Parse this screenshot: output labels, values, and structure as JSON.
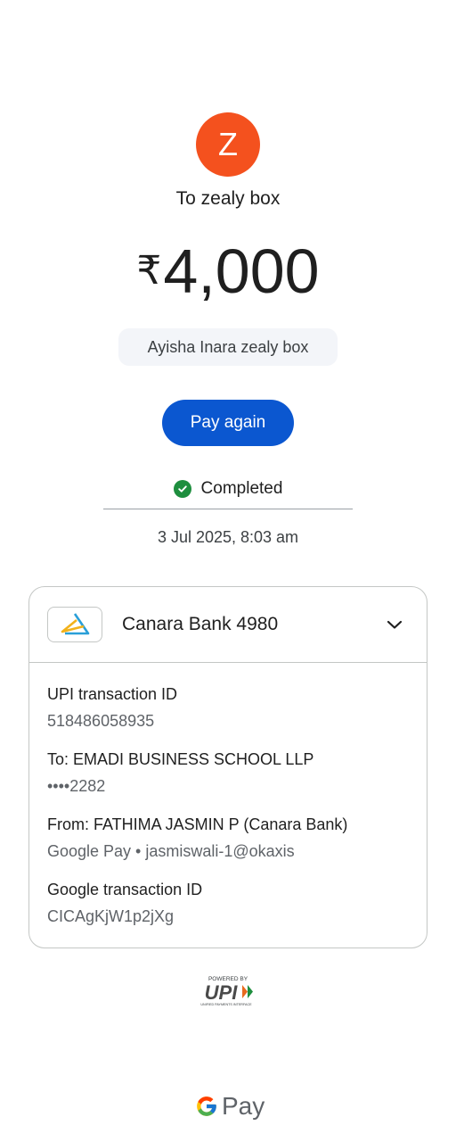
{
  "recipient": {
    "avatar_letter": "Z",
    "avatar_color": "#f4511e",
    "to_label": "To zealy box"
  },
  "payment": {
    "currency_symbol": "₹",
    "amount": "4,000",
    "note": "Ayisha Inara zealy box"
  },
  "actions": {
    "pay_again_label": "Pay again"
  },
  "status": {
    "text": "Completed",
    "icon": "check-circle-icon",
    "color": "#1e8e3e",
    "datetime": "3 Jul 2025, 8:03 am"
  },
  "account": {
    "bank_name": "Canara Bank 4980",
    "icon": "canara-bank-logo",
    "expand_icon": "chevron-down-icon"
  },
  "details": [
    {
      "label": "UPI transaction ID",
      "value": "518486058935"
    },
    {
      "label": "To: EMADI BUSINESS SCHOOL LLP",
      "value": "••••2282"
    },
    {
      "label": "From: FATHIMA JASMIN P (Canara Bank)",
      "value": "Google Pay • jasmiswali-1@okaxis"
    },
    {
      "label": "Google transaction ID",
      "value": "CICAgKjW1p2jXg"
    }
  ],
  "footer": {
    "upi_powered_by": "POWERED BY",
    "upi_brand": "UPI",
    "upi_tagline": "UNIFIED PAYMENTS INTERFACE",
    "gpay_text": "Pay"
  },
  "colors": {
    "accent": "#0b57d0",
    "success": "#1e8e3e"
  }
}
